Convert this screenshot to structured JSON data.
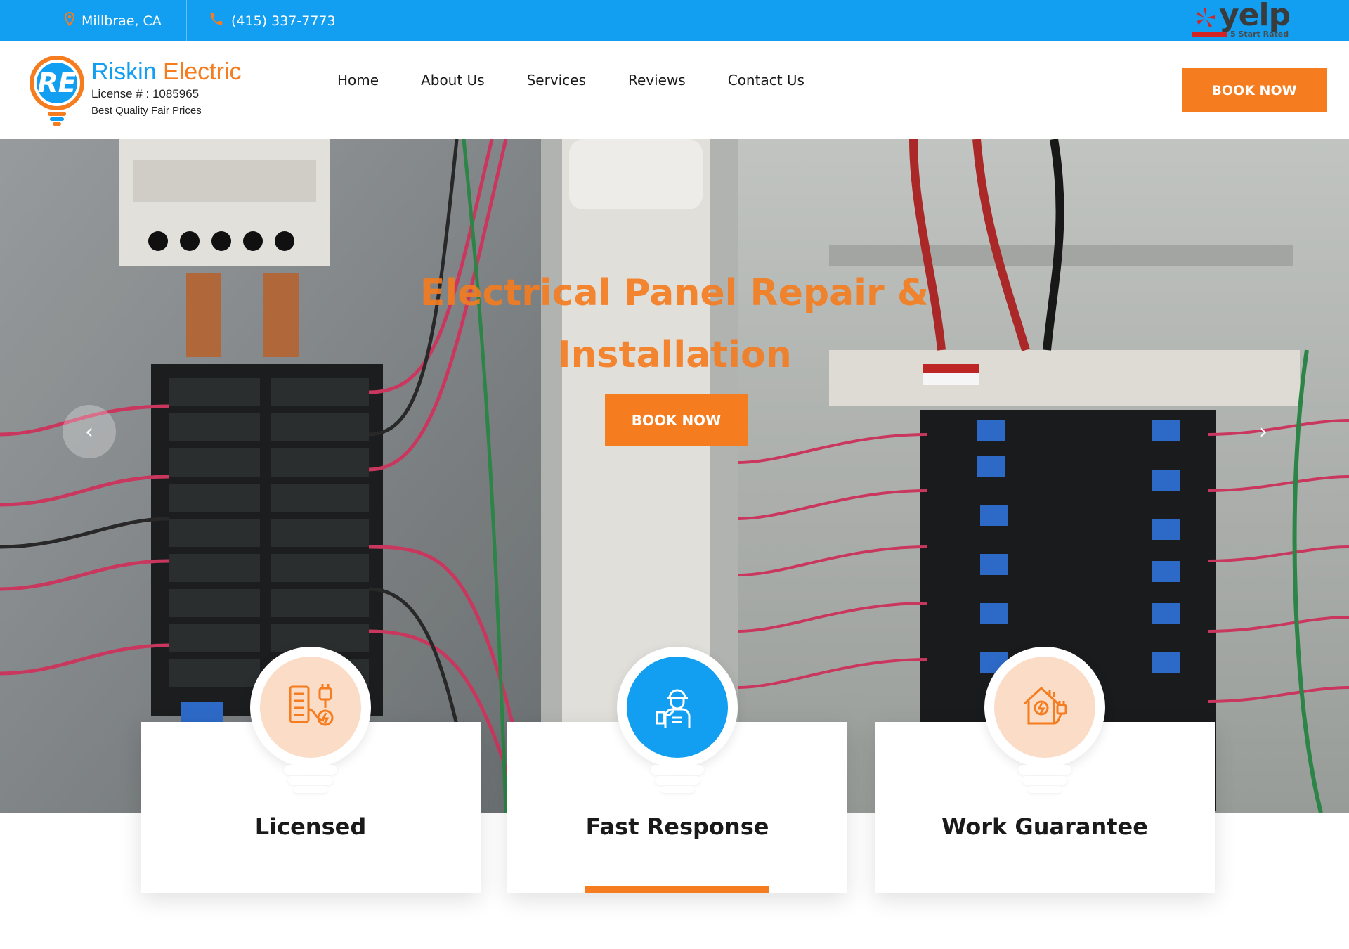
{
  "topbar": {
    "location": "Millbrae, CA",
    "phone": "(415) 337-7773",
    "yelp": {
      "word": "yelp",
      "rating_text": "5 Start Rated"
    }
  },
  "header": {
    "brand_part1": "Riskin",
    "brand_part2": "Electric",
    "license": "License # : 1085965",
    "tagline": "Best Quality Fair Prices",
    "nav": [
      "Home",
      "About Us",
      "Services",
      "Reviews",
      "Contact Us"
    ],
    "book_label": "BOOK NOW"
  },
  "hero": {
    "title": "Electrical Panel Repair & Installation",
    "book_label": "BOOK NOW",
    "prev_icon": "chevron-left-icon",
    "next_icon": "chevron-right-icon"
  },
  "features": [
    {
      "label": "Licensed",
      "icon": "panel-plug-icon"
    },
    {
      "label": "Fast Response",
      "icon": "electrician-worker-icon"
    },
    {
      "label": "Work Guarantee",
      "icon": "house-plug-icon"
    }
  ],
  "colors": {
    "brand_blue": "#129ff1",
    "brand_orange": "#f57c1f",
    "badge_peach": "#fbdcc6",
    "text_dark": "#1a1a1a"
  }
}
